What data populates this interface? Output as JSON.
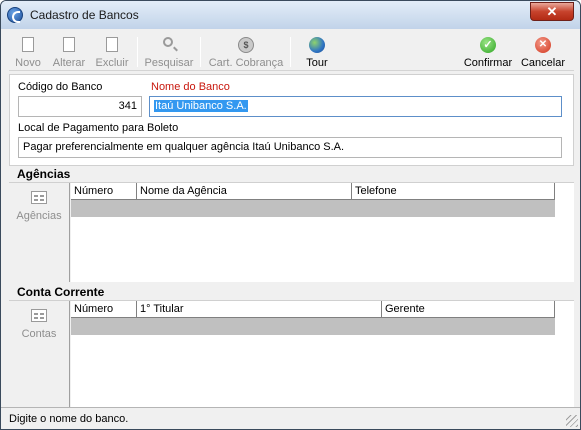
{
  "window": {
    "title": "Cadastro de Bancos",
    "close_label": "✕"
  },
  "toolbar": {
    "novo": "Novo",
    "alterar": "Alterar",
    "excluir": "Excluir",
    "pesquisar": "Pesquisar",
    "cart_cobranca": "Cart. Cobrança",
    "tour": "Tour",
    "confirmar": "Confirmar",
    "cancelar": "Cancelar"
  },
  "icons": {
    "novo": "new-document-icon",
    "alterar": "edit-document-icon",
    "excluir": "delete-document-icon",
    "pesquisar": "search-icon",
    "cart_cobranca": "coin-icon",
    "tour": "globe-icon",
    "confirmar": "check-icon",
    "cancelar": "cancel-icon"
  },
  "form": {
    "codigo_label": "Código do Banco",
    "codigo_value": "341",
    "nome_label": "Nome do Banco",
    "nome_value": "Itaú Unibanco S.A.",
    "local_label": "Local de Pagamento para Boleto",
    "local_value": "Pagar preferencialmente em qualquer agência Itaú Unibanco S.A."
  },
  "agencias": {
    "title": "Agências",
    "side_label": "Agências",
    "columns": [
      "Número",
      "Nome da Agência",
      "Telefone"
    ]
  },
  "conta_corrente": {
    "title": "Conta Corrente",
    "side_label": "Contas",
    "columns": [
      "Número",
      "1° Titular",
      "Gerente"
    ]
  },
  "status": {
    "message": "Digite o nome do banco."
  },
  "colors": {
    "required_label": "#c8170d",
    "selection": "#3398f0",
    "grid_row": "#c0c0c0"
  }
}
